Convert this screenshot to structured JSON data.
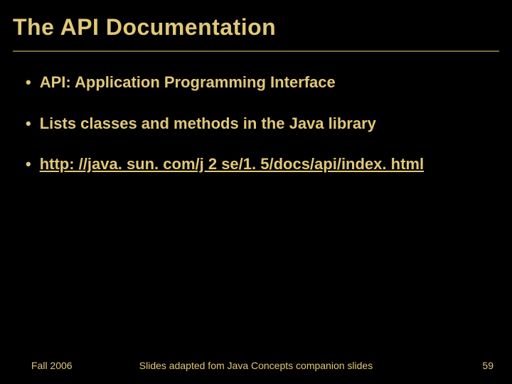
{
  "title": "The API Documentation",
  "bullets": [
    {
      "text": "API: Application Programming Interface",
      "link": false
    },
    {
      "text": "Lists classes and methods in the Java library",
      "link": false
    },
    {
      "text": "http: //java. sun. com/j 2 se/1. 5/docs/api/index. html",
      "link": true
    }
  ],
  "footer": {
    "left": "Fall 2006",
    "center": "Slides adapted fom Java Concepts companion slides",
    "right": "59"
  }
}
